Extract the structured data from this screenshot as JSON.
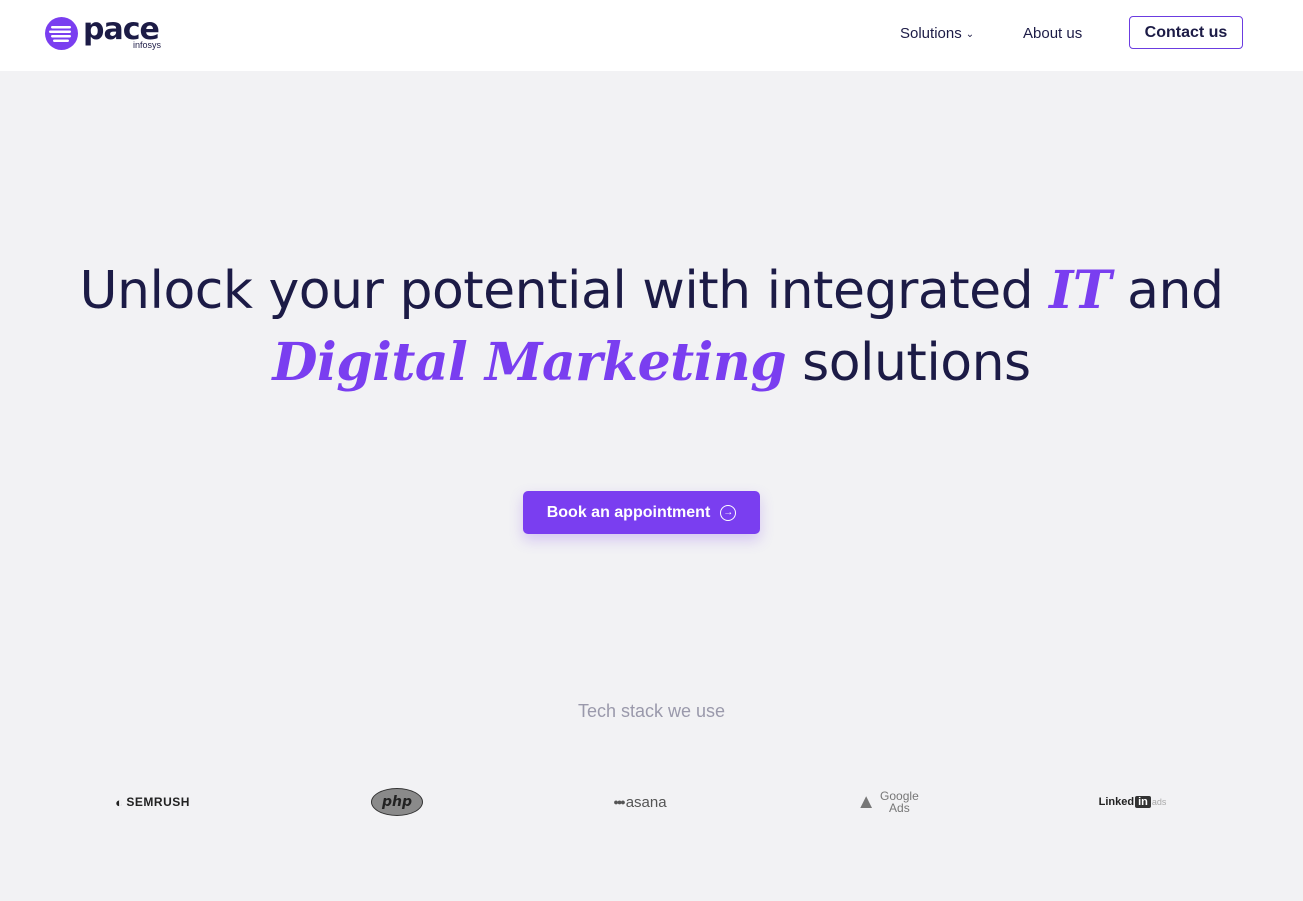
{
  "header": {
    "logo_word": "pace",
    "logo_sub": "infosys",
    "nav": {
      "solutions": "Solutions",
      "about": "About us",
      "contact": "Contact us"
    }
  },
  "hero": {
    "line1_prefix": "Unlock your potential with integrated ",
    "line1_accent": "IT",
    "line1_suffix": " and",
    "line2_accent": "Digital Marketing",
    "line2_suffix": " solutions",
    "cta_label": "Book an appointment"
  },
  "tech_stack": {
    "title": "Tech stack we use",
    "logos": {
      "semrush": "SEMRUSH",
      "php": "php",
      "asana": "asana",
      "google_top": "Google",
      "google_bottom": "Ads",
      "linkedin_word": "Linked",
      "linkedin_in": "in",
      "linkedin_ads": "ads"
    }
  },
  "colors": {
    "brand": "#7a3ef0",
    "text_dark": "#1c1b46",
    "background": "#f2f2f4"
  }
}
